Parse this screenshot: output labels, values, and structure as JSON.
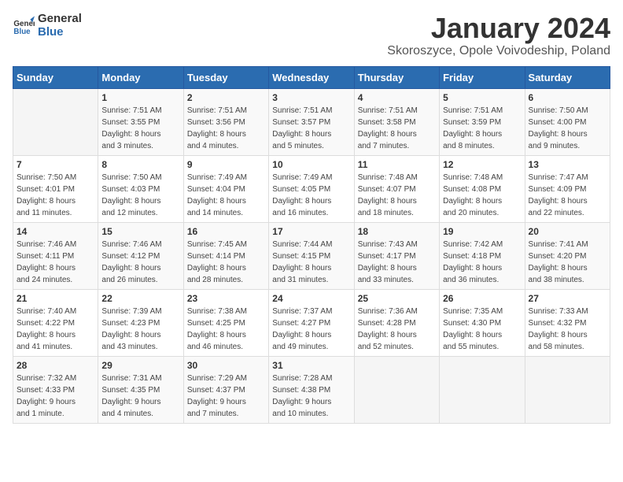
{
  "logo": {
    "text_general": "General",
    "text_blue": "Blue"
  },
  "title": "January 2024",
  "subtitle": "Skoroszyce, Opole Voivodeship, Poland",
  "days_of_week": [
    "Sunday",
    "Monday",
    "Tuesday",
    "Wednesday",
    "Thursday",
    "Friday",
    "Saturday"
  ],
  "weeks": [
    [
      {
        "day": "",
        "info": ""
      },
      {
        "day": "1",
        "info": "Sunrise: 7:51 AM\nSunset: 3:55 PM\nDaylight: 8 hours\nand 3 minutes."
      },
      {
        "day": "2",
        "info": "Sunrise: 7:51 AM\nSunset: 3:56 PM\nDaylight: 8 hours\nand 4 minutes."
      },
      {
        "day": "3",
        "info": "Sunrise: 7:51 AM\nSunset: 3:57 PM\nDaylight: 8 hours\nand 5 minutes."
      },
      {
        "day": "4",
        "info": "Sunrise: 7:51 AM\nSunset: 3:58 PM\nDaylight: 8 hours\nand 7 minutes."
      },
      {
        "day": "5",
        "info": "Sunrise: 7:51 AM\nSunset: 3:59 PM\nDaylight: 8 hours\nand 8 minutes."
      },
      {
        "day": "6",
        "info": "Sunrise: 7:50 AM\nSunset: 4:00 PM\nDaylight: 8 hours\nand 9 minutes."
      }
    ],
    [
      {
        "day": "7",
        "info": "Sunrise: 7:50 AM\nSunset: 4:01 PM\nDaylight: 8 hours\nand 11 minutes."
      },
      {
        "day": "8",
        "info": "Sunrise: 7:50 AM\nSunset: 4:03 PM\nDaylight: 8 hours\nand 12 minutes."
      },
      {
        "day": "9",
        "info": "Sunrise: 7:49 AM\nSunset: 4:04 PM\nDaylight: 8 hours\nand 14 minutes."
      },
      {
        "day": "10",
        "info": "Sunrise: 7:49 AM\nSunset: 4:05 PM\nDaylight: 8 hours\nand 16 minutes."
      },
      {
        "day": "11",
        "info": "Sunrise: 7:48 AM\nSunset: 4:07 PM\nDaylight: 8 hours\nand 18 minutes."
      },
      {
        "day": "12",
        "info": "Sunrise: 7:48 AM\nSunset: 4:08 PM\nDaylight: 8 hours\nand 20 minutes."
      },
      {
        "day": "13",
        "info": "Sunrise: 7:47 AM\nSunset: 4:09 PM\nDaylight: 8 hours\nand 22 minutes."
      }
    ],
    [
      {
        "day": "14",
        "info": "Sunrise: 7:46 AM\nSunset: 4:11 PM\nDaylight: 8 hours\nand 24 minutes."
      },
      {
        "day": "15",
        "info": "Sunrise: 7:46 AM\nSunset: 4:12 PM\nDaylight: 8 hours\nand 26 minutes."
      },
      {
        "day": "16",
        "info": "Sunrise: 7:45 AM\nSunset: 4:14 PM\nDaylight: 8 hours\nand 28 minutes."
      },
      {
        "day": "17",
        "info": "Sunrise: 7:44 AM\nSunset: 4:15 PM\nDaylight: 8 hours\nand 31 minutes."
      },
      {
        "day": "18",
        "info": "Sunrise: 7:43 AM\nSunset: 4:17 PM\nDaylight: 8 hours\nand 33 minutes."
      },
      {
        "day": "19",
        "info": "Sunrise: 7:42 AM\nSunset: 4:18 PM\nDaylight: 8 hours\nand 36 minutes."
      },
      {
        "day": "20",
        "info": "Sunrise: 7:41 AM\nSunset: 4:20 PM\nDaylight: 8 hours\nand 38 minutes."
      }
    ],
    [
      {
        "day": "21",
        "info": "Sunrise: 7:40 AM\nSunset: 4:22 PM\nDaylight: 8 hours\nand 41 minutes."
      },
      {
        "day": "22",
        "info": "Sunrise: 7:39 AM\nSunset: 4:23 PM\nDaylight: 8 hours\nand 43 minutes."
      },
      {
        "day": "23",
        "info": "Sunrise: 7:38 AM\nSunset: 4:25 PM\nDaylight: 8 hours\nand 46 minutes."
      },
      {
        "day": "24",
        "info": "Sunrise: 7:37 AM\nSunset: 4:27 PM\nDaylight: 8 hours\nand 49 minutes."
      },
      {
        "day": "25",
        "info": "Sunrise: 7:36 AM\nSunset: 4:28 PM\nDaylight: 8 hours\nand 52 minutes."
      },
      {
        "day": "26",
        "info": "Sunrise: 7:35 AM\nSunset: 4:30 PM\nDaylight: 8 hours\nand 55 minutes."
      },
      {
        "day": "27",
        "info": "Sunrise: 7:33 AM\nSunset: 4:32 PM\nDaylight: 8 hours\nand 58 minutes."
      }
    ],
    [
      {
        "day": "28",
        "info": "Sunrise: 7:32 AM\nSunset: 4:33 PM\nDaylight: 9 hours\nand 1 minute."
      },
      {
        "day": "29",
        "info": "Sunrise: 7:31 AM\nSunset: 4:35 PM\nDaylight: 9 hours\nand 4 minutes."
      },
      {
        "day": "30",
        "info": "Sunrise: 7:29 AM\nSunset: 4:37 PM\nDaylight: 9 hours\nand 7 minutes."
      },
      {
        "day": "31",
        "info": "Sunrise: 7:28 AM\nSunset: 4:38 PM\nDaylight: 9 hours\nand 10 minutes."
      },
      {
        "day": "",
        "info": ""
      },
      {
        "day": "",
        "info": ""
      },
      {
        "day": "",
        "info": ""
      }
    ]
  ]
}
